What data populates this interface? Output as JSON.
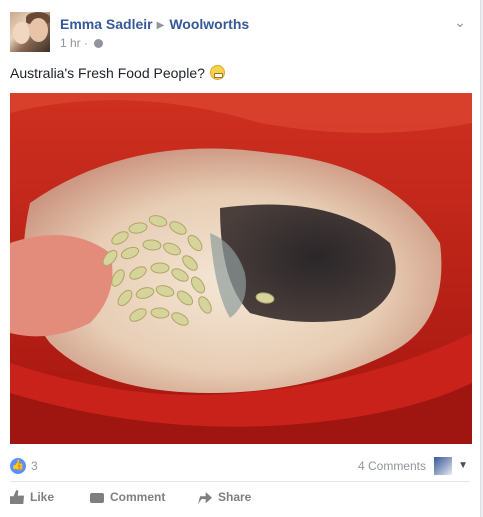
{
  "post": {
    "author": "Emma Sadleir",
    "target_page": "Woolworths",
    "timestamp": "1 hr",
    "separator": "·",
    "audience_icon": "globe-icon",
    "options_icon": "chevron-down-icon",
    "message": "Australia's Fresh Food People?",
    "message_emoji": "grimace-emoji"
  },
  "reactions": {
    "like_count": "3",
    "comments_label": "4 Comments"
  },
  "actions": {
    "like": "Like",
    "comment": "Comment",
    "share": "Share"
  },
  "colors": {
    "link": "#365899",
    "meta": "#90949c",
    "like_blue": "#5890ff",
    "pepper_red": "#c8231a"
  }
}
